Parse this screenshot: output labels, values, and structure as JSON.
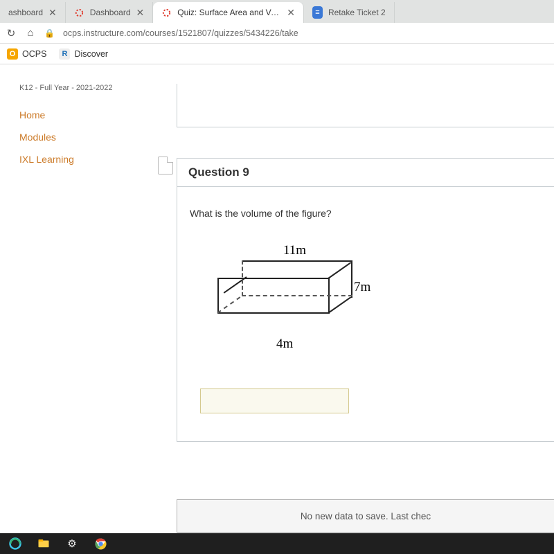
{
  "tabs": [
    {
      "title": "ashboard",
      "favicon": "generic"
    },
    {
      "title": "Dashboard",
      "favicon": "canvas"
    },
    {
      "title": "Quiz: Surface Area and Volume R",
      "favicon": "canvas",
      "active": true
    },
    {
      "title": "Retake Ticket 2",
      "favicon": "doc"
    }
  ],
  "address_bar": {
    "url": "ocps.instructure.com/courses/1521807/quizzes/5434226/take"
  },
  "bookmarks": [
    {
      "label": "OCPS",
      "icon": "ocps"
    },
    {
      "label": "Discover",
      "icon": "discover"
    }
  ],
  "sidebar": {
    "course_label": "K12 - Full Year - 2021-2022",
    "items": [
      {
        "label": "Home"
      },
      {
        "label": "Modules"
      },
      {
        "label": "IXL Learning"
      }
    ]
  },
  "question": {
    "number_label": "Question 9",
    "prompt": "What is the volume of the figure?",
    "figure": {
      "top_label": "11m",
      "right_label": "7m",
      "bottom_label": "4m"
    },
    "answer_value": ""
  },
  "save_status": "No new data to save. Last chec"
}
